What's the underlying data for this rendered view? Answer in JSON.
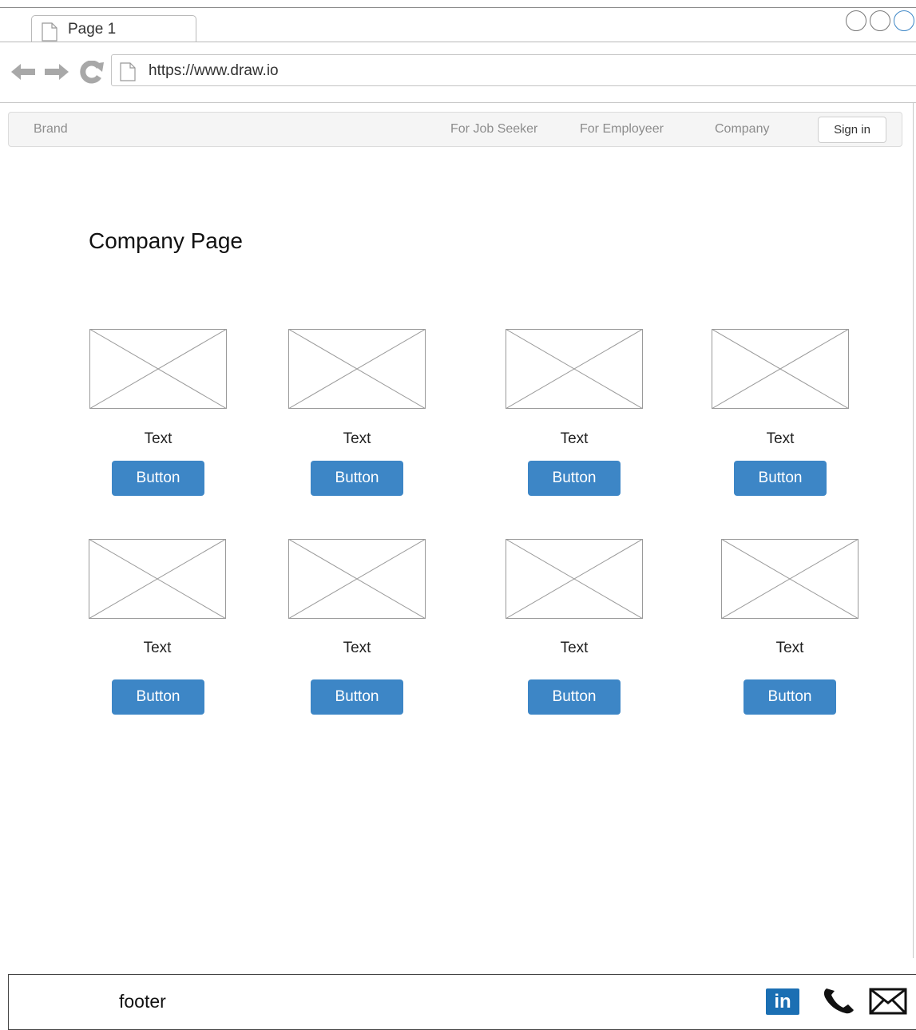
{
  "browser": {
    "tab_title": "Page 1",
    "url": "https://www.draw.io"
  },
  "navbar": {
    "brand": "Brand",
    "links": [
      "For Job Seeker",
      "For Employeer",
      "Company"
    ],
    "signin_label": "Sign in"
  },
  "page": {
    "title": "Company Page"
  },
  "cards": [
    {
      "text": "Text",
      "button": "Button"
    },
    {
      "text": "Text",
      "button": "Button"
    },
    {
      "text": "Text",
      "button": "Button"
    },
    {
      "text": "Text",
      "button": "Button"
    },
    {
      "text": "Text",
      "button": "Button"
    },
    {
      "text": "Text",
      "button": "Button"
    },
    {
      "text": "Text",
      "button": "Button"
    },
    {
      "text": "Text",
      "button": "Button"
    }
  ],
  "footer": {
    "label": "footer",
    "icons": [
      "linkedin-icon",
      "phone-icon",
      "mail-icon"
    ],
    "linkedin_text": "in"
  },
  "colors": {
    "button": "#3d86c6",
    "linkedin": "#1b6fb3"
  }
}
